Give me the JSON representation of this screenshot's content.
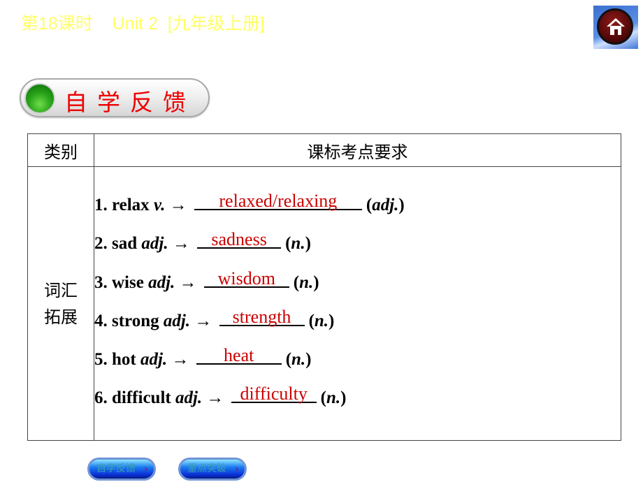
{
  "header": {
    "title": "第18课时    Unit 2  [九年级上册]",
    "home_icon": "home-icon"
  },
  "section": {
    "label": "自学反馈",
    "icon": "green-dot-icon"
  },
  "table": {
    "headers": [
      "类别",
      "课标考点要求"
    ],
    "category": "词汇\n拓展",
    "category_lines": [
      "词汇",
      "拓展"
    ],
    "items": [
      {
        "num": "1.",
        "word": "relax",
        "pos": "v.",
        "arrow": "→",
        "answer": "relaxed/relaxing",
        "target": "adj."
      },
      {
        "num": "2.",
        "word": "sad",
        "pos": "adj.",
        "arrow": "→",
        "answer": "sadness",
        "target": "n."
      },
      {
        "num": "3.",
        "word": "wise",
        "pos": "adj.",
        "arrow": "→",
        "answer": "wisdom",
        "target": "n."
      },
      {
        "num": "4.",
        "word": "strong",
        "pos": "adj.",
        "arrow": "→",
        "answer": "strength",
        "target": "n."
      },
      {
        "num": "5.",
        "word": "hot",
        "pos": "adj.",
        "arrow": "→",
        "answer": "heat",
        "target": "n."
      },
      {
        "num": "6.",
        "word": "difficult",
        "pos": "adj.",
        "arrow": "→",
        "answer": "difficulty",
        "target": "n."
      }
    ]
  },
  "nav": {
    "buttons": [
      {
        "label": "自学反馈",
        "icon": "chevron-right-icon"
      },
      {
        "label": "重点突破",
        "icon": "chevron-right-icon"
      }
    ],
    "chevron": "›"
  },
  "colors": {
    "title": "#ffff66",
    "answer": "#cc0000",
    "section_label": "#ee0000"
  }
}
